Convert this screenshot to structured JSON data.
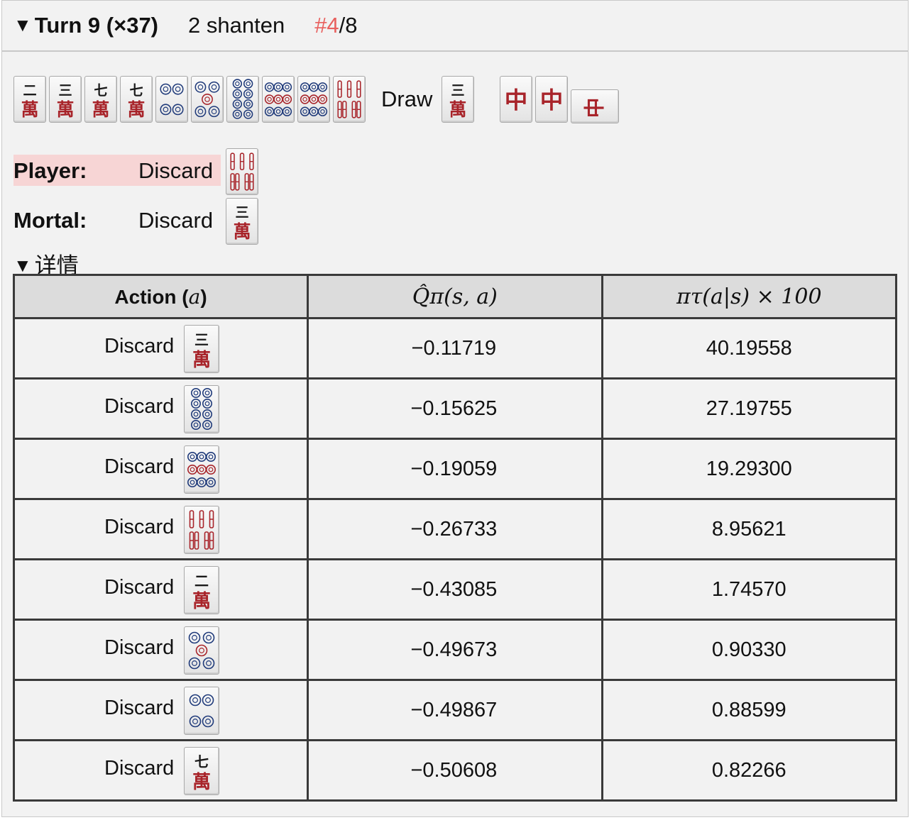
{
  "header": {
    "turn_label": "Turn 9 (×37)",
    "shanten": "2 shanten",
    "rank_highlight": "#4",
    "rank_total": "/8",
    "rank_color": "#e8605e"
  },
  "hand": {
    "tiles": [
      "2m",
      "3m",
      "7m",
      "7m",
      "4p",
      "5p",
      "8p",
      "9p",
      "9p",
      "7s"
    ],
    "draw_label": "Draw",
    "draw_tile": "3m",
    "meld_tiles": [
      "chun",
      "chun",
      "chun-sideways"
    ]
  },
  "player": {
    "label": "Player:",
    "action": "Discard",
    "tile": "7s"
  },
  "mortal": {
    "label": "Mortal:",
    "action": "Discard",
    "tile": "3m"
  },
  "details": {
    "label": "详情"
  },
  "table": {
    "headers": [
      "Action (a)",
      "Q̂π(s, a)",
      "πτ(a|s) × 100"
    ],
    "rows": [
      {
        "action": "Discard",
        "tile": "3m",
        "q": "−0.11719",
        "pi": "40.19558"
      },
      {
        "action": "Discard",
        "tile": "8p",
        "q": "−0.15625",
        "pi": "27.19755"
      },
      {
        "action": "Discard",
        "tile": "9p",
        "q": "−0.19059",
        "pi": "19.29300"
      },
      {
        "action": "Discard",
        "tile": "7s",
        "q": "−0.26733",
        "pi": "8.95621"
      },
      {
        "action": "Discard",
        "tile": "2m",
        "q": "−0.43085",
        "pi": "1.74570"
      },
      {
        "action": "Discard",
        "tile": "5p",
        "q": "−0.49673",
        "pi": "0.90330"
      },
      {
        "action": "Discard",
        "tile": "4p",
        "q": "−0.49867",
        "pi": "0.88599"
      },
      {
        "action": "Discard",
        "tile": "7m",
        "q": "−0.50608",
        "pi": "0.82266"
      }
    ]
  }
}
